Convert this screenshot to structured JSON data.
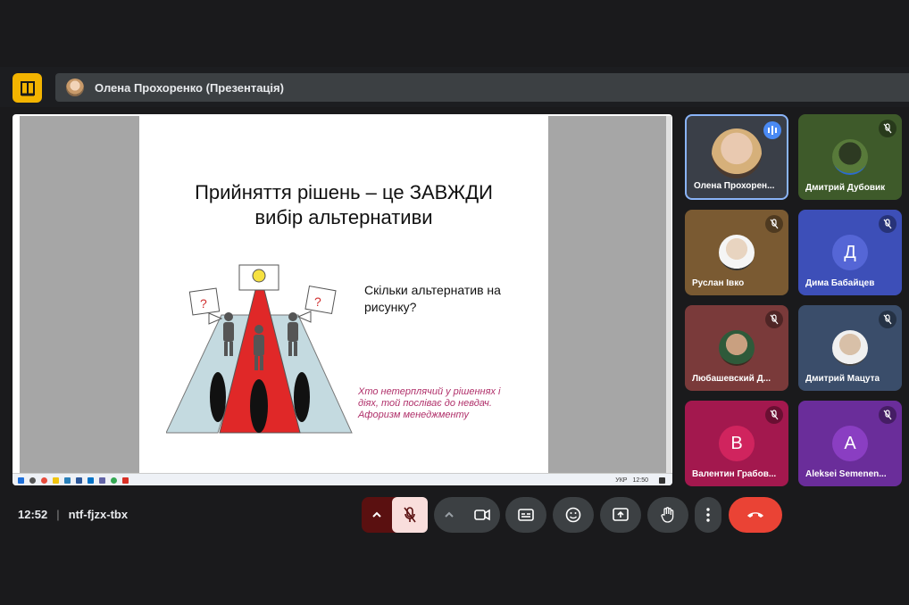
{
  "meeting": {
    "presenter_label": "Олена Прохоренко (Презентація)",
    "time": "12:52",
    "code": "ntf-fjzx-tbx"
  },
  "slide": {
    "title_line1": "Прийняття рішень – це ЗАВЖДИ",
    "title_line2": "вибір альтернативи",
    "question_line1": "Скільки альтернатив на",
    "question_line2": "рисунку?",
    "quote_line1": "Хто нетерплячий у рішеннях і",
    "quote_line2": "діях, той посліває до невдач.",
    "quote_line3": "Афоризм менеджменту"
  },
  "taskbar": {
    "lang": "УКР",
    "clock": "12:50"
  },
  "participants": [
    {
      "name": "Олена Прохорен...",
      "status": "speaking"
    },
    {
      "name": "Дмитрий Дубовик",
      "status": "muted"
    },
    {
      "name": "Руслан Івко",
      "status": "muted"
    },
    {
      "name": "Дима Бабайцев",
      "status": "muted",
      "initial": "Д"
    },
    {
      "name": "Любашевский Д...",
      "status": "muted"
    },
    {
      "name": "Дмитрий Мацута",
      "status": "muted"
    },
    {
      "name": "Валентин Грабов...",
      "status": "muted",
      "initial": "В"
    },
    {
      "name": "Aleksei Semenen...",
      "status": "muted",
      "initial": "А"
    }
  ],
  "colors": {
    "accent_logo": "#f3b400",
    "leave_red": "#ea4335",
    "mic_muted_bg": "#f9dedc"
  },
  "icons": [
    "logo-icon",
    "mic-off-icon",
    "chevron-up-icon",
    "camera-icon",
    "captions-icon",
    "emoji-icon",
    "present-icon",
    "hand-icon",
    "more-icon",
    "hangup-icon"
  ]
}
